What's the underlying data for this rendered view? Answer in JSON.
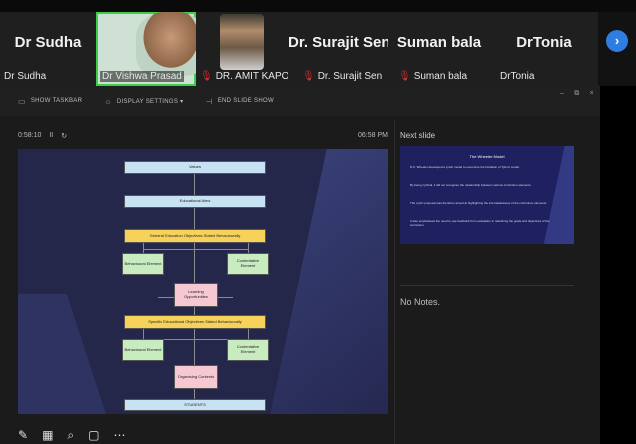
{
  "participants": [
    {
      "display_name": "Dr Sudha",
      "label": "Dr Sudha",
      "muted": false,
      "video": false
    },
    {
      "display_name": "",
      "label": "Dr Vishwa Prasad",
      "muted": false,
      "video": true,
      "speaking": true
    },
    {
      "display_name": "",
      "label": "DR. AMIT KAPOOR",
      "muted": true,
      "video": true
    },
    {
      "display_name": "Dr. Surajit Sen",
      "label": "Dr. Surajit Sen",
      "muted": true,
      "video": false
    },
    {
      "display_name": "Suman bala",
      "label": "Suman bala",
      "muted": true,
      "video": false
    },
    {
      "display_name": "DrTonia",
      "label": "DrTonia",
      "muted": false,
      "video": false
    }
  ],
  "next_icon": "chevron-right-icon",
  "toolbar": {
    "show_taskbar": "SHOW TASKBAR",
    "display_settings": "DISPLAY SETTINGS ▾",
    "end_slide_show": "END SLIDE SHOW",
    "minimize": "–",
    "restore": "⧉",
    "close": "×"
  },
  "timer": {
    "elapsed": "0:58:10",
    "pause": "II",
    "reset": "↻"
  },
  "clock": "06:58 PM",
  "next_slide_label": "Next slide",
  "slide": {
    "boxes": {
      "values": "Values",
      "aims": "Educational Aims",
      "general": "General Education Objectives Stated Behaviourally",
      "beh1": "Behavioural Element",
      "cont1": "Contentative Element",
      "learning": "Learning Opportunities",
      "specific": "Specific Educational Objectives Stated Behaviourally",
      "beh2": "Behavioural Element",
      "cont2": "Contentative Element",
      "organising": "Organising Contents",
      "students": "STUDENTS"
    }
  },
  "next_slide": {
    "title": "The Wheeler Model",
    "lines": [
      "D.K. Wheeler developed a cyclic model to overcome the limitation of Tyler's model.",
      "By being cyclical, it did not recognise the relationship between various curriculum elements.",
      "The cyclic proposal was therefore aimed at highlighting the interrelatedness of the curriculum elements.",
      "It also emphasised the need to use feedback from evaluation in redefining the goals and objectives of the curriculum."
    ]
  },
  "notes": "No Notes.",
  "tools": [
    "✎",
    "▦",
    "⌕",
    "▢",
    "⋯"
  ],
  "colors": {
    "accent_blue": "#2f7de1",
    "speaking_border": "#3ecf4a",
    "mute_red": "#e0282f"
  }
}
